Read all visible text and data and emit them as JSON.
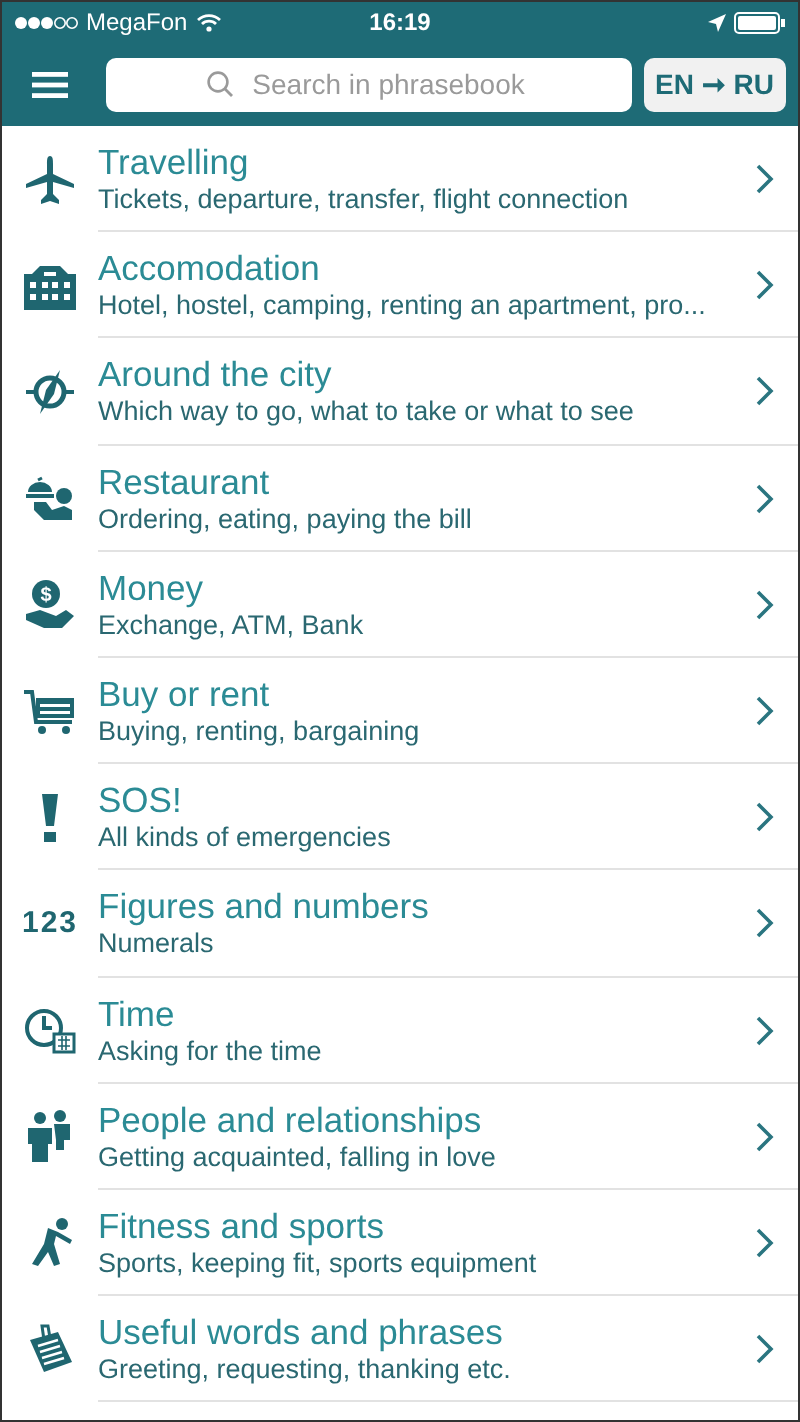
{
  "status_bar": {
    "carrier": "MegaFon",
    "time": "16:19"
  },
  "header": {
    "search": {
      "placeholder": "Search in phrasebook"
    },
    "language_pair": {
      "from": "EN",
      "arrow": "➞",
      "to": "RU"
    }
  },
  "categories": [
    {
      "kind": "plane",
      "title": "Travelling",
      "subtitle": "Tickets, departure, transfer, flight connection"
    },
    {
      "kind": "building",
      "title": "Accomodation",
      "subtitle": "Hotel, hostel, camping, renting an apartment, pro..."
    },
    {
      "kind": "compass",
      "title": "Around the city",
      "subtitle": "Which way to go, what to take or what to see"
    },
    {
      "kind": "waiter",
      "title": "Restaurant",
      "subtitle": "Ordering, eating, paying the bill"
    },
    {
      "kind": "coin",
      "icon_text": "$",
      "title": "Money",
      "subtitle": "Exchange, ATM, Bank"
    },
    {
      "kind": "cart",
      "title": "Buy or rent",
      "subtitle": "Buying, renting, bargaining"
    },
    {
      "kind": "exclamation",
      "title": "SOS!",
      "subtitle": "All kinds of emergencies"
    },
    {
      "kind": "digits",
      "icon_text": "123",
      "title": "Figures and numbers",
      "subtitle": "Numerals"
    },
    {
      "kind": "clock",
      "title": "Time",
      "subtitle": "Asking for the time"
    },
    {
      "kind": "people",
      "title": "People and relationships",
      "subtitle": "Getting acquainted, falling in love"
    },
    {
      "kind": "runner",
      "title": "Fitness and sports",
      "subtitle": "Sports, keeping fit, sports equipment"
    },
    {
      "kind": "notepad",
      "title": "Useful words and phrases",
      "subtitle": "Greeting, requesting, thanking etc."
    }
  ]
}
